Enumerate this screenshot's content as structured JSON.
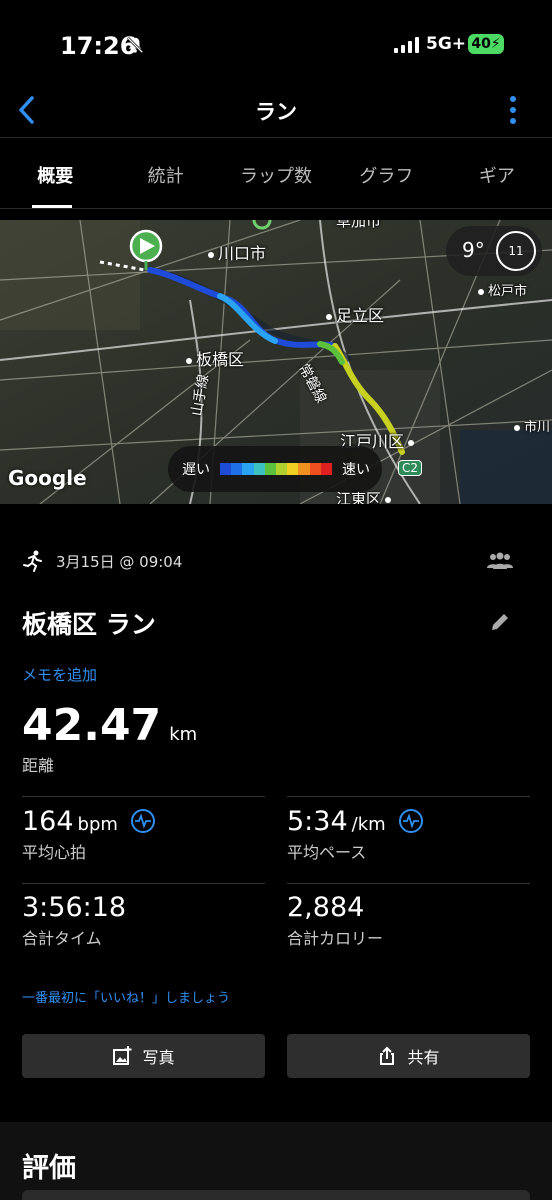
{
  "status_bar": {
    "time": "17:26",
    "network": "5G+",
    "battery": "40"
  },
  "header": {
    "title": "ラン",
    "back_icon": "chevron-left-icon",
    "more_icon": "vertical-dots-icon"
  },
  "tabs": [
    {
      "label": "概要",
      "active": true
    },
    {
      "label": "統計",
      "active": false
    },
    {
      "label": "ラップ数",
      "active": false
    },
    {
      "label": "グラフ",
      "active": false
    },
    {
      "label": "ギア",
      "active": false
    }
  ],
  "map": {
    "labels": {
      "kawaguchi": "川口市",
      "adachi": "足立区",
      "itabashi": "板橋区",
      "edogawa": "江戸川区",
      "matsudo": "松戸市",
      "ichikawa": "市川",
      "koto": "江東区",
      "joban": "常磐線",
      "yamanote": "山手線",
      "soka": "草加市",
      "c2": "C2"
    },
    "weather": {
      "temp": "9°",
      "clock": "11"
    },
    "attribution": "Google",
    "legend": {
      "slow": "遅い",
      "fast": "速い",
      "colors": [
        "#1e4bd8",
        "#1f6fe8",
        "#2aa3f0",
        "#3cc0c0",
        "#5cc03c",
        "#b0d030",
        "#f0d020",
        "#f09020",
        "#f05020",
        "#e02020"
      ]
    }
  },
  "activity": {
    "date": "3月15日 @ 09:04",
    "title": "板橋区 ラン",
    "add_memo": "メモを追加",
    "distance": {
      "value": "42.47",
      "unit": "km",
      "label": "距離"
    },
    "stats": {
      "avg_hr": {
        "value": "164",
        "unit": "bpm",
        "label": "平均心拍"
      },
      "avg_pace": {
        "value": "5:34",
        "unit": "/km",
        "label": "平均ペース"
      },
      "total_time": {
        "value": "3:56:18",
        "label": "合計タイム"
      },
      "total_cal": {
        "value": "2,884",
        "label": "合計カロリー"
      }
    },
    "like_prompt": "一番最初に「いいね！」しましょう",
    "photo_button": "写真",
    "share_button": "共有",
    "rating_title": "評価"
  }
}
